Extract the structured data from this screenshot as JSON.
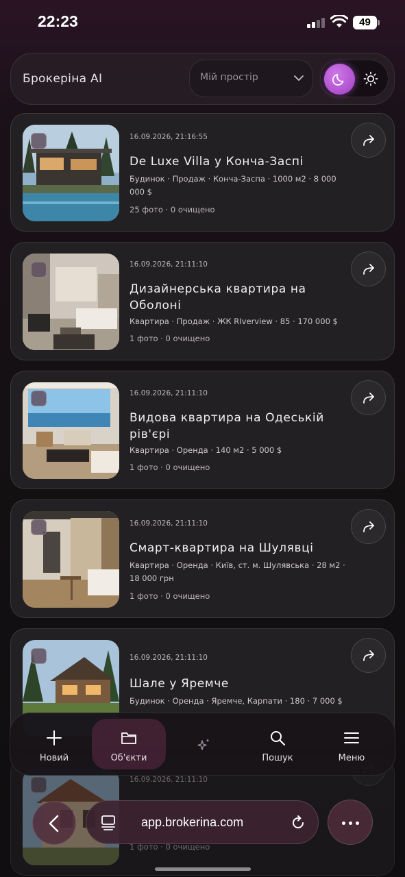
{
  "status": {
    "time": "22:23",
    "battery": "49"
  },
  "header": {
    "brand": "Брокеріна AI",
    "workspace_label": "Мій простір",
    "theme_active": "dark"
  },
  "listings": [
    {
      "date": "16.09.2026, 21:16:55",
      "title": "De Luxe Villa у Конча-Заспі",
      "meta": "Будинок · Продаж · Конча-Заспа · 1000 м2 · 8 000 000 $",
      "stats": "25 фото · 0 очищено",
      "image": "villa-pool-photo"
    },
    {
      "date": "16.09.2026, 21:11:10",
      "title": "Дизайнерська квартира на Оболоні",
      "meta": "Квартира · Продаж · ЖК RIverview · 85 · 170 000 $",
      "stats": "1 фото · 0 очищено",
      "image": "living-room-photo"
    },
    {
      "date": "16.09.2026, 21:11:10",
      "title": "Видова квартира на Одеській рів'єрі",
      "meta": "Квартира · Оренда · 140 м2 · 5 000 $",
      "stats": "1 фото · 0 очищено",
      "image": "sea-view-living-room-photo"
    },
    {
      "date": "16.09.2026, 21:11:10",
      "title": "Смарт-квартира на Шулявці",
      "meta": "Квартира · Оренда · Київ, ст. м. Шулявська · 28 м2 · 18 000 грн",
      "stats": "1 фото · 0 очищено",
      "image": "studio-kitchen-photo"
    },
    {
      "date": "16.09.2026, 21:11:10",
      "title": "Шале у Яремче",
      "meta": "Будинок · Оренда · Яремче, Карпати · 180 · 7 000 $",
      "stats": "",
      "image": "chalet-photo"
    },
    {
      "date": "16.09.2026, 21:11:10",
      "title": "",
      "meta": "",
      "stats": "1 фото · 0 очищено",
      "image": "stone-house-photo"
    }
  ],
  "bottom_nav": [
    {
      "label": "Новий",
      "icon": "plus-icon"
    },
    {
      "label": "Об'єкти",
      "icon": "folder-icon",
      "active": true
    },
    {
      "label": "",
      "icon": "sparkle-icon"
    },
    {
      "label": "Пошук",
      "icon": "search-icon"
    },
    {
      "label": "Меню",
      "icon": "menu-icon"
    }
  ],
  "browser": {
    "url": "app.brokerina.com"
  },
  "colors": {
    "accent": "#b04fd6",
    "card_bg": "#222022",
    "nav_active": "#46233a"
  }
}
